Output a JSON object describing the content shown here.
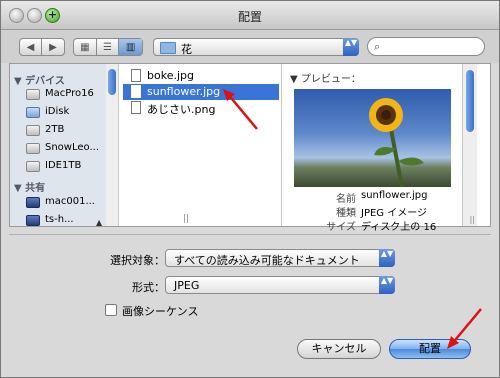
{
  "window": {
    "title": "配置"
  },
  "toolbar": {
    "back_icon": "◀",
    "forward_icon": "▶",
    "view_icons": [
      "▦",
      "☰",
      "▥"
    ],
    "path_label": "花",
    "popup_arrows": "▲▼",
    "search_placeholder": ""
  },
  "sidebar": {
    "devices_header": "▼ デバイス",
    "devices": [
      {
        "label": "MacPro16"
      },
      {
        "label": "iDisk"
      },
      {
        "label": "2TB"
      },
      {
        "label": "SnowLeo..."
      },
      {
        "label": "IDE1TB"
      }
    ],
    "shared_header": "▼ 共有",
    "shared": [
      {
        "label": "mac001..."
      },
      {
        "label": "ts-h..."
      }
    ]
  },
  "files": [
    {
      "name": "boke.jpg"
    },
    {
      "name": "sunflower.jpg",
      "selected": true
    },
    {
      "name": "あじさい.png"
    }
  ],
  "preview": {
    "header": "▼ プレビュー：",
    "name_key": "名前",
    "name_value": "sunflower.jpg",
    "kind_key": "種類",
    "kind_value": "JPEG イメージ",
    "size_key": "サイズ",
    "size_value": "ディスク上の 16"
  },
  "options": {
    "enable_label": "選択対象：",
    "enable_value": "すべての読み込み可能なドキュメント",
    "format_label": "形式：",
    "format_value": "JPEG",
    "sequence_label": "画像シーケンス",
    "sequence_checked": false
  },
  "buttons": {
    "cancel": "キャンセル",
    "place": "配置"
  },
  "colors": {
    "selection": "#3875d7",
    "annotation_arrow": "#e01010"
  }
}
